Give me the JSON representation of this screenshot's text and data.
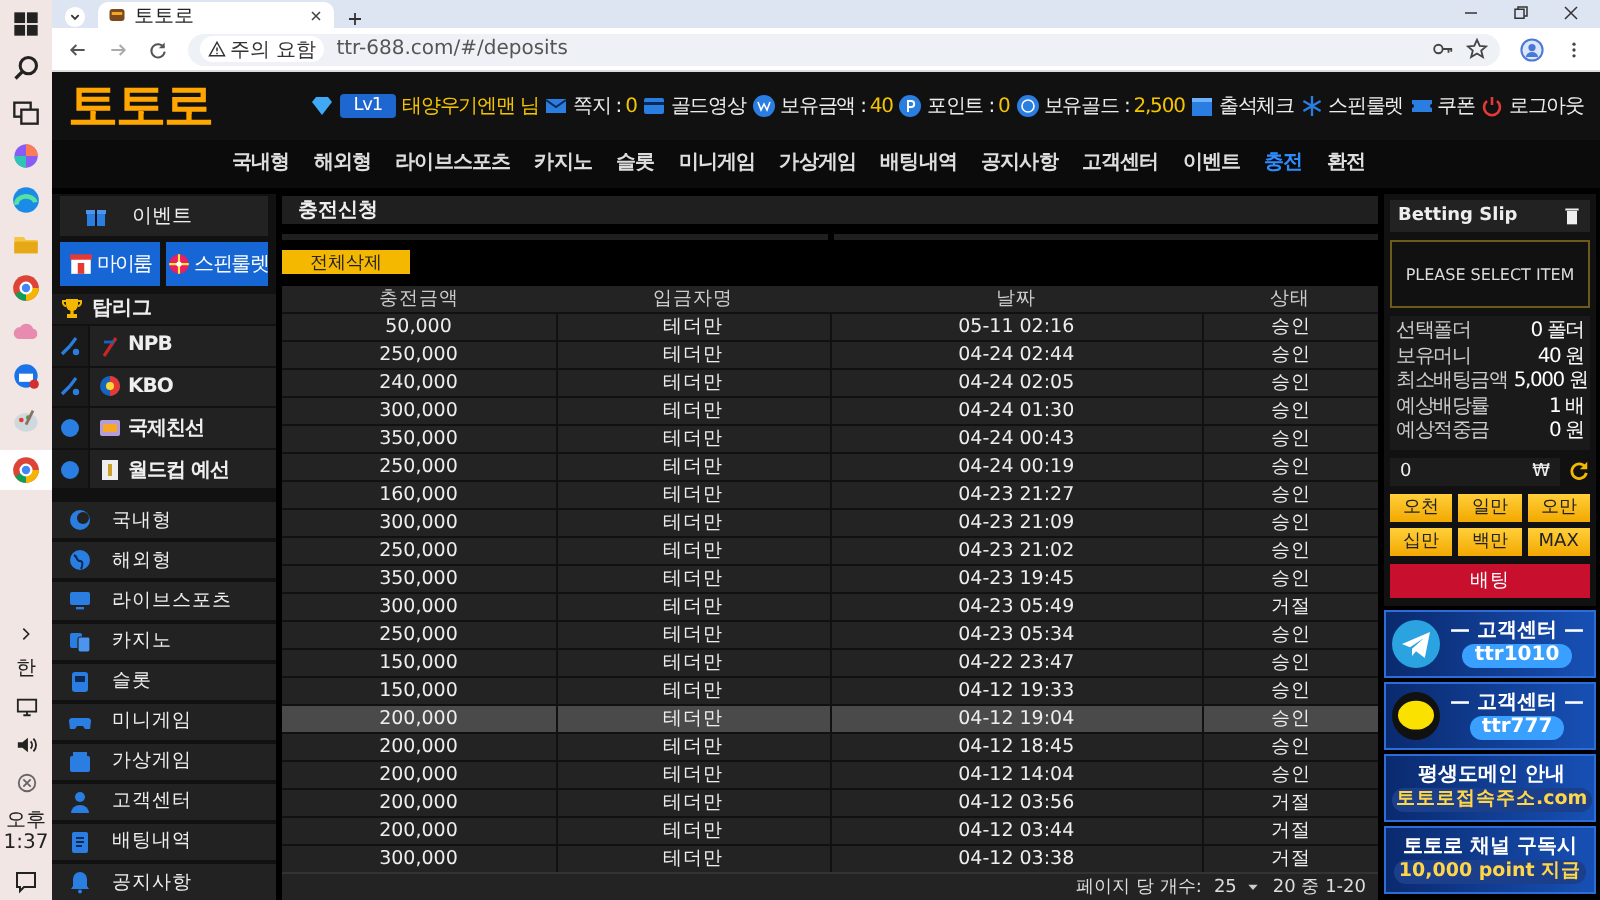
{
  "taskbar": {
    "ime": "한",
    "time": "오후 1:37"
  },
  "browser": {
    "tab_title": "토토로",
    "security": "주의 요함",
    "url": "ttr-688.com/#/deposits"
  },
  "header": {
    "logo": "토토로",
    "level": "Lv1",
    "user": "태양우기엔맨 님",
    "items": [
      {
        "kind": "mail",
        "label": "쪽지 : ",
        "value": "0"
      },
      {
        "kind": "card",
        "label": "골드영상",
        "value": ""
      },
      {
        "kind": "won",
        "label": "보유금액 : ",
        "value": "40"
      },
      {
        "kind": "point",
        "label": "포인트 : ",
        "value": "0"
      },
      {
        "kind": "gold",
        "label": "보유골드 : ",
        "value": "2,500"
      },
      {
        "kind": "calendar",
        "label": "출석체크",
        "value": ""
      },
      {
        "kind": "spin",
        "label": "스핀룰렛",
        "value": ""
      },
      {
        "kind": "coupon",
        "label": "쿠폰",
        "value": ""
      },
      {
        "kind": "logout",
        "label": "로그아웃",
        "value": ""
      }
    ]
  },
  "nav": [
    {
      "label": "국내형",
      "selected": false
    },
    {
      "label": "해외형",
      "selected": false
    },
    {
      "label": "라이브스포츠",
      "selected": false
    },
    {
      "label": "카지노",
      "selected": false
    },
    {
      "label": "슬롯",
      "selected": false
    },
    {
      "label": "미니게임",
      "selected": false
    },
    {
      "label": "가상게임",
      "selected": false
    },
    {
      "label": "배팅내역",
      "selected": false
    },
    {
      "label": "공지사항",
      "selected": false
    },
    {
      "label": "고객센터",
      "selected": false
    },
    {
      "label": "이벤트",
      "selected": false
    },
    {
      "label": "충전",
      "selected": true
    },
    {
      "label": "환전",
      "selected": false
    }
  ],
  "sidebar": {
    "event": "이벤트",
    "buttons": [
      {
        "kind": "myroom",
        "label": "마이룸"
      },
      {
        "kind": "spin",
        "label": "스핀룰렛"
      }
    ],
    "top_league": {
      "label": "탑리그",
      "items": [
        {
          "kind": "baseball",
          "label": "NPB"
        },
        {
          "kind": "baseball",
          "label": "KBO"
        },
        {
          "kind": "soccer",
          "label": "국제친선"
        },
        {
          "kind": "soccer",
          "label": "월드컵 예선"
        }
      ]
    },
    "menu": [
      {
        "kind": "domestic",
        "label": "국내형"
      },
      {
        "kind": "globe",
        "label": "해외형"
      },
      {
        "kind": "monitor",
        "label": "라이브스포츠"
      },
      {
        "kind": "cards",
        "label": "카지노"
      },
      {
        "kind": "slot",
        "label": "슬롯"
      },
      {
        "kind": "gamepad",
        "label": "미니게임"
      },
      {
        "kind": "box",
        "label": "가상게임"
      },
      {
        "kind": "person",
        "label": "고객센터"
      },
      {
        "kind": "document",
        "label": "배팅내역"
      },
      {
        "kind": "bell",
        "label": "공지사항"
      }
    ]
  },
  "content": {
    "title": "충전신청",
    "delete_button": "전체삭제",
    "table": {
      "columns": [
        "충전금액",
        "입금자명",
        "날짜",
        "상태"
      ],
      "rows": [
        {
          "amount": "50,000",
          "depositor": "테더만",
          "date": "05-11 02:16",
          "status": "승인",
          "highlighted": false
        },
        {
          "amount": "250,000",
          "depositor": "테더만",
          "date": "04-24 02:44",
          "status": "승인",
          "highlighted": false
        },
        {
          "amount": "240,000",
          "depositor": "테더만",
          "date": "04-24 02:05",
          "status": "승인",
          "highlighted": false
        },
        {
          "amount": "300,000",
          "depositor": "테더만",
          "date": "04-24 01:30",
          "status": "승인",
          "highlighted": false
        },
        {
          "amount": "350,000",
          "depositor": "테더만",
          "date": "04-24 00:43",
          "status": "승인",
          "highlighted": false
        },
        {
          "amount": "250,000",
          "depositor": "테더만",
          "date": "04-24 00:19",
          "status": "승인",
          "highlighted": false
        },
        {
          "amount": "160,000",
          "depositor": "테더만",
          "date": "04-23 21:27",
          "status": "승인",
          "highlighted": false
        },
        {
          "amount": "300,000",
          "depositor": "테더만",
          "date": "04-23 21:09",
          "status": "승인",
          "highlighted": false
        },
        {
          "amount": "250,000",
          "depositor": "테더만",
          "date": "04-23 21:02",
          "status": "승인",
          "highlighted": false
        },
        {
          "amount": "350,000",
          "depositor": "테더만",
          "date": "04-23 19:45",
          "status": "승인",
          "highlighted": false
        },
        {
          "amount": "300,000",
          "depositor": "테더만",
          "date": "04-23 05:49",
          "status": "거절",
          "highlighted": false
        },
        {
          "amount": "250,000",
          "depositor": "테더만",
          "date": "04-23 05:34",
          "status": "승인",
          "highlighted": false
        },
        {
          "amount": "150,000",
          "depositor": "테더만",
          "date": "04-22 23:47",
          "status": "승인",
          "highlighted": false
        },
        {
          "amount": "150,000",
          "depositor": "테더만",
          "date": "04-12 19:33",
          "status": "승인",
          "highlighted": false
        },
        {
          "amount": "200,000",
          "depositor": "테더만",
          "date": "04-12 19:04",
          "status": "승인",
          "highlighted": true
        },
        {
          "amount": "200,000",
          "depositor": "테더만",
          "date": "04-12 18:45",
          "status": "승인",
          "highlighted": false
        },
        {
          "amount": "200,000",
          "depositor": "테더만",
          "date": "04-12 14:04",
          "status": "승인",
          "highlighted": false
        },
        {
          "amount": "200,000",
          "depositor": "테더만",
          "date": "04-12 03:56",
          "status": "거절",
          "highlighted": false
        },
        {
          "amount": "200,000",
          "depositor": "테더만",
          "date": "04-12 03:44",
          "status": "거절",
          "highlighted": false
        },
        {
          "amount": "300,000",
          "depositor": "테더만",
          "date": "04-12 03:38",
          "status": "거절",
          "highlighted": false
        }
      ]
    },
    "pagination": {
      "per_page_label": "페이지 당 개수:",
      "per_page": "25",
      "range": "20 중 1-20"
    }
  },
  "bet_slip": {
    "title": "Betting Slip",
    "empty": "PLEASE SELECT ITEM",
    "info": [
      {
        "label": "선택폴더",
        "value": "0 폴더"
      },
      {
        "label": "보유머니",
        "value": "40 원"
      },
      {
        "label": "최소배팅금액",
        "value": "5,000 원"
      },
      {
        "label": "예상배당률",
        "value": "1 배"
      },
      {
        "label": "예상적중금",
        "value": "0 원"
      }
    ],
    "amount": "0",
    "currency": "₩",
    "quick_buttons": [
      "오천",
      "일만",
      "오만",
      "십만",
      "백만",
      "MAX"
    ],
    "bet_button": "배팅"
  },
  "banners": [
    {
      "kind": "telegram",
      "heading": "— 고객센터 —",
      "text": "ttr1010"
    },
    {
      "kind": "kakao",
      "heading": "— 고객센터 —",
      "text": "ttr777"
    },
    {
      "kind": "domain",
      "heading": "평생도메인 안내",
      "text": "토토로접속주소.com"
    },
    {
      "kind": "channel",
      "heading": "토토로 채널 구독시",
      "text": "10,000 point 지급"
    }
  ]
}
